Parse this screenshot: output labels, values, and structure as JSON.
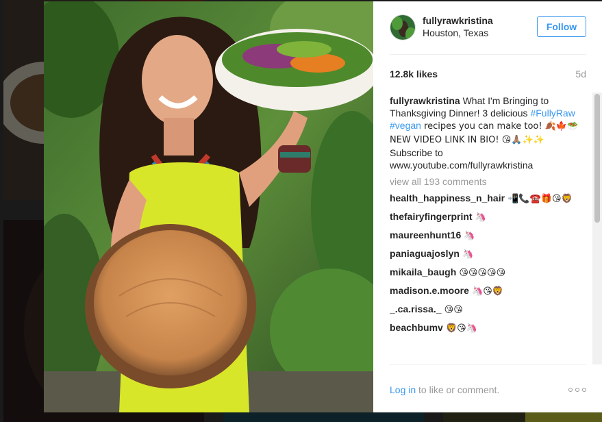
{
  "post": {
    "username": "fullyrawkristina",
    "location": "Houston, Texas",
    "follow_label": "Follow",
    "likes": "12.8k likes",
    "age": "5d",
    "caption_user": "fullyrawkristina",
    "caption_part1": " What I'm Bringing to Thanksgiving Dinner! 3 delicious ",
    "hashtag1": "#FullyRaw",
    "hashtag2": "#vegan",
    "caption_part2": " recipes you can make too! 🍂🍁🥗 NEW VIDEO LINK IN BIO! 😘🙏🏽✨✨",
    "subscribe_line": "Subscribe to",
    "youtube_url": "www.youtube.com/fullyrawkristina",
    "view_all": "view all 193 comments",
    "comments": [
      {
        "user": "health_happiness_n_hair",
        "text": " 📲📞☎️🎁😘🦁"
      },
      {
        "user": "thefairyfingerprint",
        "text": " 🦄"
      },
      {
        "user": "maureenhunt16",
        "text": " 🦄"
      },
      {
        "user": "paniaguajoslyn",
        "text": " 🦄"
      },
      {
        "user": "mikaila_baugh",
        "text": " 😘😘😘😘😘"
      },
      {
        "user": "madison.e.moore",
        "text": " 🦄😘🦁"
      },
      {
        "user": "_.ca.rissa._",
        "text": " 😘😘"
      },
      {
        "user": "beachbumv",
        "text": " 🦁😘🦄"
      }
    ],
    "login_link": "Log in",
    "login_rest": " to like or comment."
  },
  "colors": {
    "accent": "#3897f0",
    "text": "#262626",
    "muted": "#999999",
    "dress": "#d8e62a"
  },
  "icons": {
    "more": "more-options-icon",
    "avatar": "profile-avatar"
  }
}
